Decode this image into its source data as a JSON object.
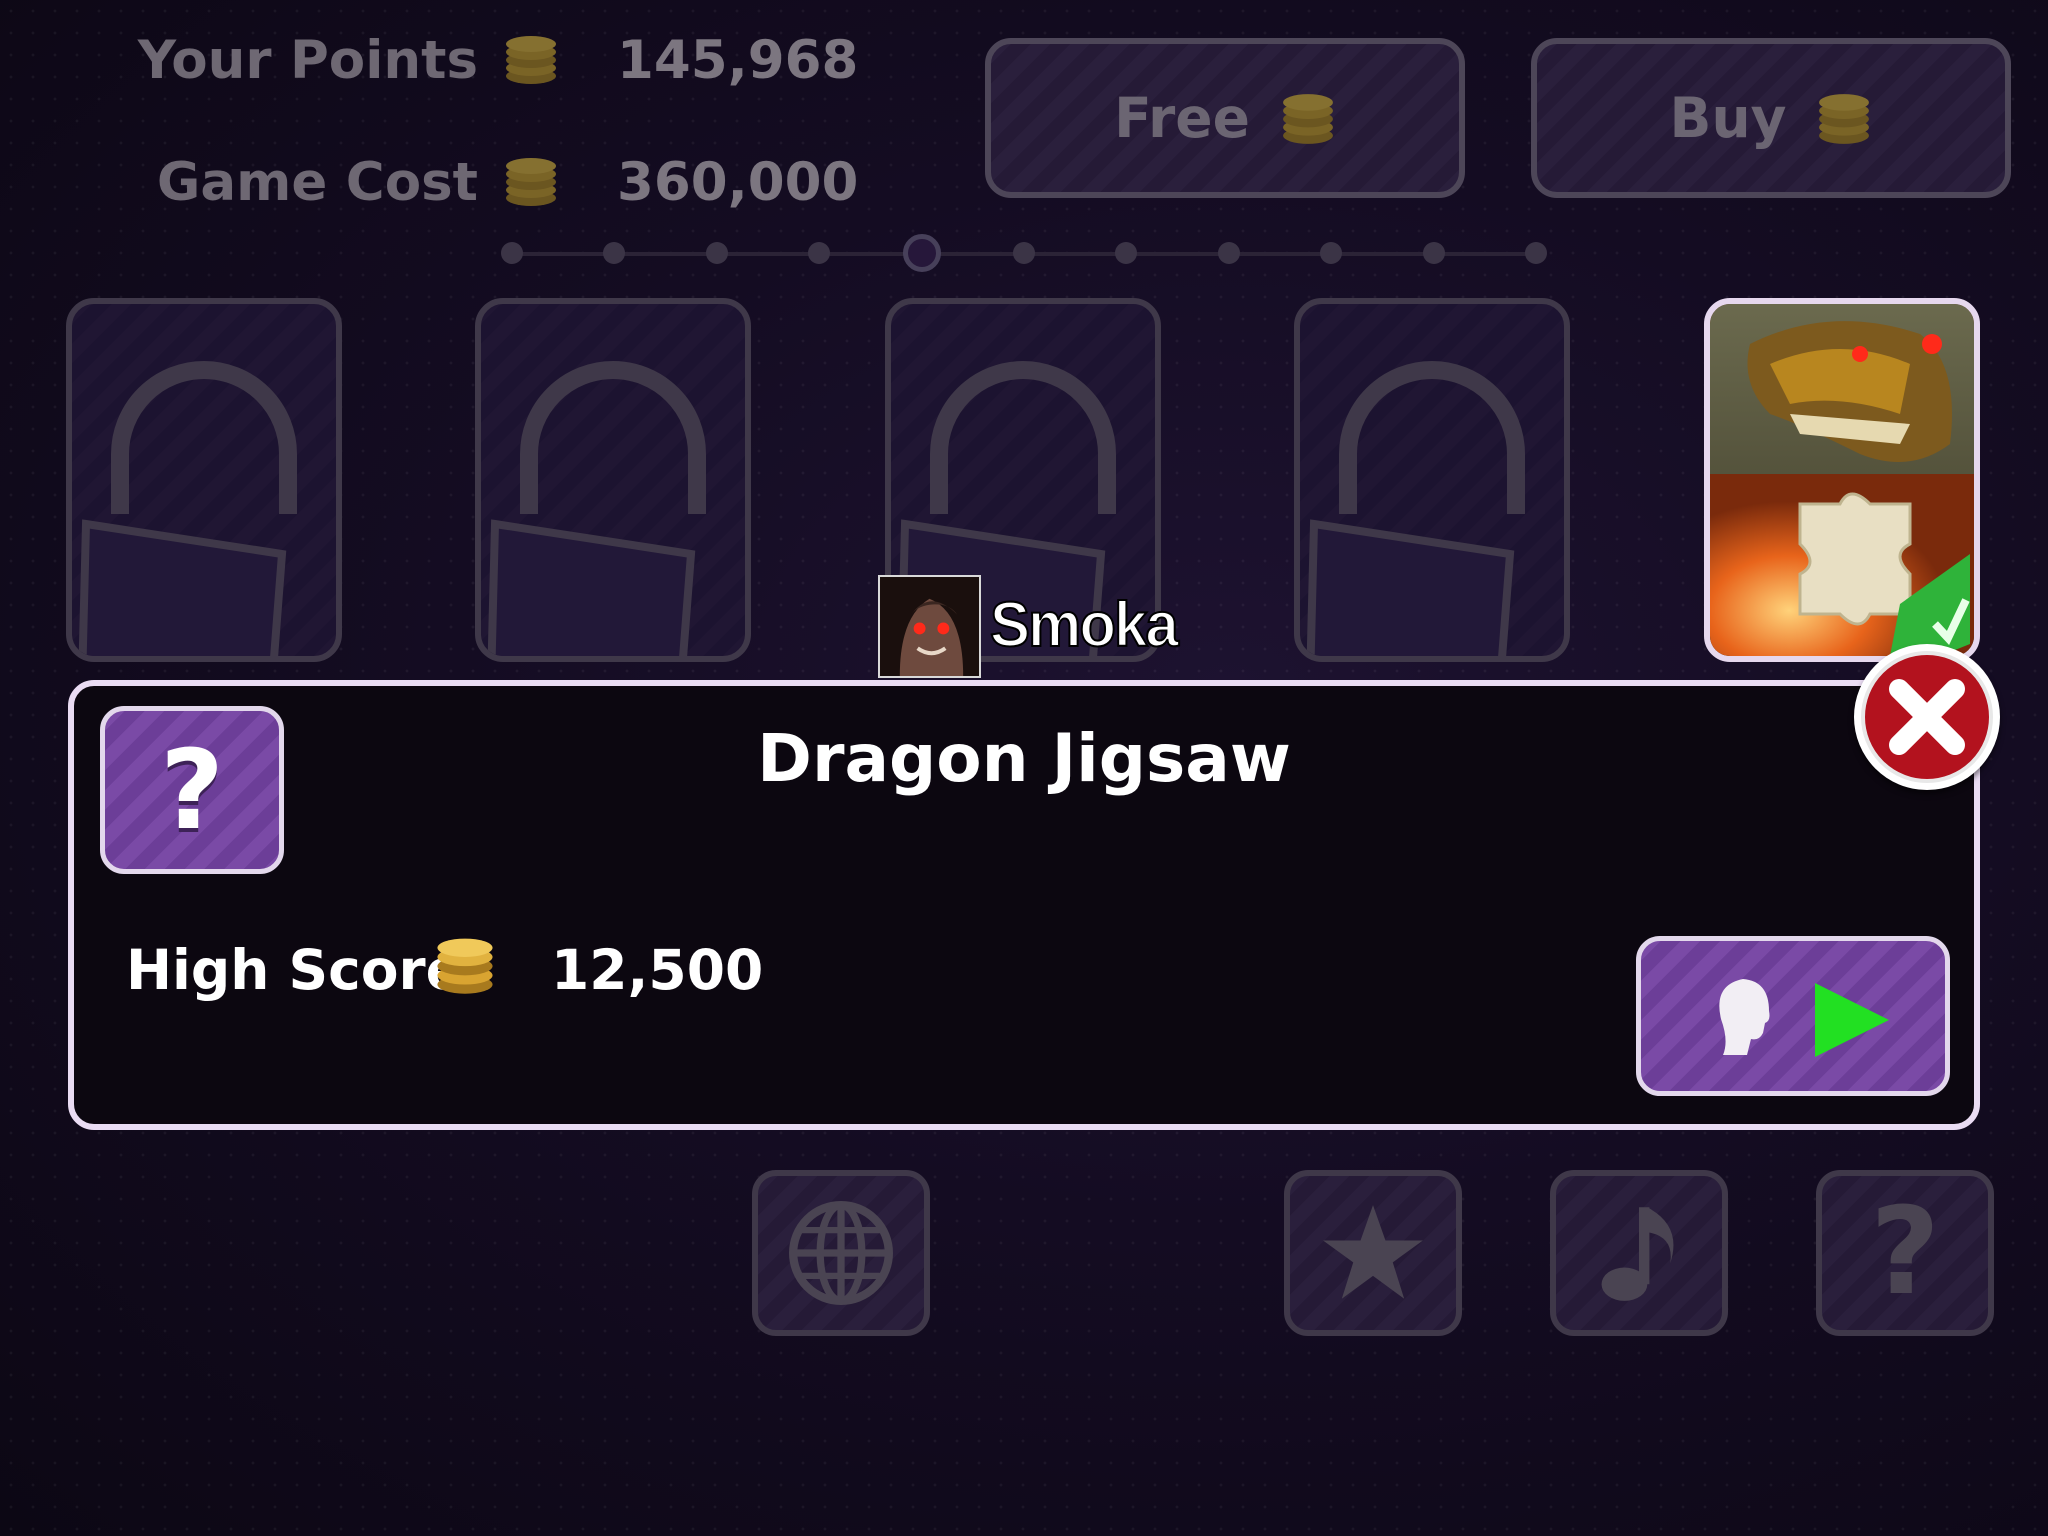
{
  "stats": {
    "points_label": "Your Points",
    "points_value": "145,968",
    "cost_label": "Game Cost",
    "cost_value": "360,000"
  },
  "top_buttons": {
    "free_label": "Free",
    "buy_label": "Buy"
  },
  "pager": {
    "total": 11,
    "active_index": 4
  },
  "cards": [
    {
      "state": "locked"
    },
    {
      "state": "locked"
    },
    {
      "state": "locked"
    },
    {
      "state": "locked"
    },
    {
      "state": "unlocked",
      "completed": true
    }
  ],
  "profile": {
    "name": "Smoka"
  },
  "dialog": {
    "title": "Dragon Jigsaw",
    "help_symbol": "?",
    "high_score_label": "High Score",
    "high_score_value": "12,500"
  },
  "toolbar": [
    "globe-icon",
    "star-icon",
    "music-note-icon",
    "question-icon"
  ],
  "colors": {
    "button_purple": "#7a4aa6",
    "play_green": "#22e022",
    "close_red": "#b3121e",
    "coin_gold": "#d9a431"
  }
}
